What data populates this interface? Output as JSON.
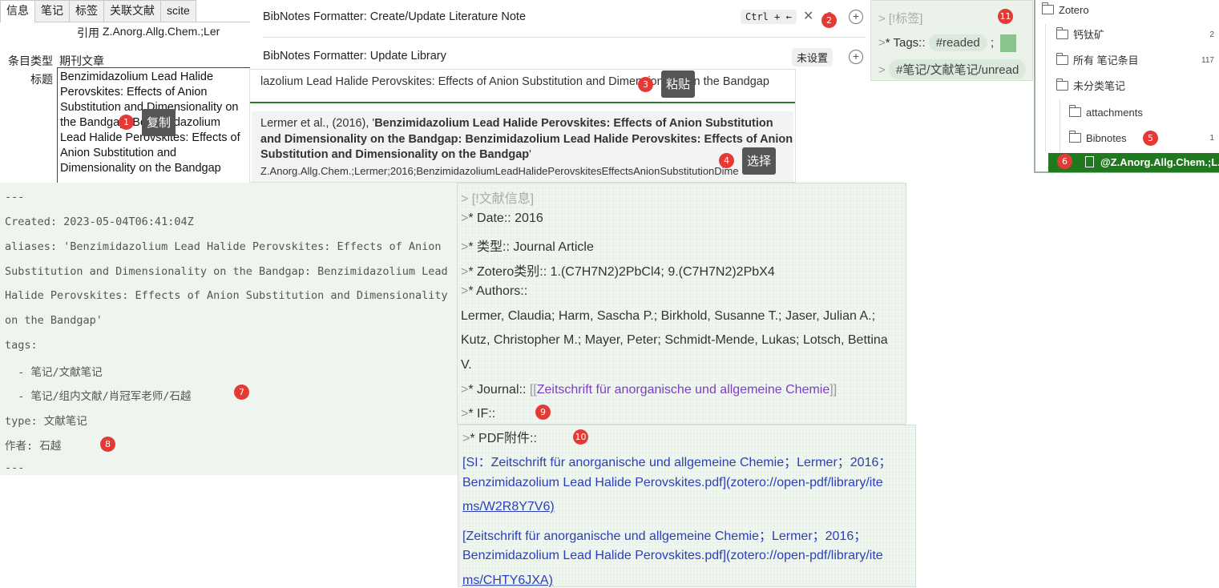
{
  "zotero": {
    "tabs": [
      "信息",
      "笔记",
      "标签",
      "关联文献",
      "scite"
    ],
    "cite_label": "引用",
    "cite_value": "Z.Anorg.Allg.Chem.;Ler",
    "item_type_label": "条目类型",
    "item_type_value": "期刊文章",
    "title_label": "标题",
    "title_lines": [
      "Benzimidazolium Lead Halide",
      "Perovskites: Effects of Anion",
      "Substitution and Dimensionality on",
      "the Bandgap: Benzimidazolium",
      "Lead Halide Perovskites: Effects of",
      "Anion Substitution and",
      "Dimensionality on the Bandgap"
    ]
  },
  "palette": {
    "cmd1_label": "BibNotes Formatter: Create/Update Literature Note",
    "cmd1_hotkey": "Ctrl + ←",
    "cmd2_label": "BibNotes Formatter: Update Library",
    "cmd2_hotkey": "未设置"
  },
  "search": {
    "query": "lazolium Lead Halide Perovskites: Effects of Anion Substitution and Dimensionality on the Bandgap",
    "result_prefix": "Lermer et al., (2016), '",
    "result_bold": "Benzimidazolium Lead Halide Perovskites: Effects of Anion Substitution and Dimensionality on the Bandgap: Benzimidazolium Lead Halide Perovskites: Effects of Anion Substitution and Dimensionality on the Bandgap",
    "result_suffix": "'",
    "result_key": "Z.Anorg.Allg.Chem.;Lermer;2016;BenzimidazoliumLeadHalidePerovskitesEffectsAnionSubstitutionDime"
  },
  "tags_callout": {
    "header": "> [!标签]",
    "tags_label": "* Tags::",
    "tag1": "#readed",
    "sep": ";",
    "tag2": "#笔记/文献笔记/unread"
  },
  "tree": {
    "root": "Zotero",
    "items": [
      {
        "label": "钙钛矿",
        "count": "2"
      },
      {
        "label": "所有 笔记条目",
        "count": "117"
      },
      {
        "label": "未分类笔记",
        "count": ""
      },
      {
        "label": "attachments",
        "count": ""
      },
      {
        "label": "Bibnotes",
        "count": "1"
      }
    ],
    "selected_file": "@Z.Anorg.Allg.Chem.;L..."
  },
  "yaml": {
    "lines": [
      "---",
      "Created: 2023-05-04T06:41:04Z",
      "aliases: 'Benzimidazolium Lead Halide Perovskites: Effects of Anion",
      "Substitution and Dimensionality on the Bandgap: Benzimidazolium Lead",
      "Halide Perovskites: Effects of Anion Substitution and Dimensionality",
      "on the Bandgap'",
      "tags:",
      "  - 笔记/文献笔记",
      "  - 笔记/组内文献/肖冠军老师/石越",
      "type: 文献笔记",
      "作者: 石越",
      "---"
    ]
  },
  "literature": {
    "header": "> [!文献信息]",
    "date": "* Date:: 2016",
    "type": "* 类型:: Journal Article",
    "category": "* Zotero类别:: 1.(C7H7N2)2PbCl4; 9.(C7H7N2)2PbX4",
    "authors_label": "* Authors::",
    "authors_lines": [
      "Lermer, Claudia; Harm, Sascha P.; Birkhold, Susanne T.; Jaser, Julian A.;",
      "Kutz, Christopher M.; Mayer, Peter; Schmidt-Mende, Lukas; Lotsch, Bettina",
      "V."
    ],
    "journal_label": "* Journal::",
    "journal_link": "Zeitschrift für anorganische und allgemeine Chemie",
    "if_label": "* IF::"
  },
  "pdf": {
    "label": "* PDF附件::",
    "lines": [
      "[SI：Zeitschrift für anorganische und allgemeine Chemie；Lermer；2016；",
      "Benzimidazolium Lead Halide Perovskites.pdf](zotero://open-pdf/library/ite",
      "ms/W2R8Y7V6)",
      "[Zeitschrift für anorganische und allgemeine Chemie；Lermer；2016；",
      "Benzimidazolium Lead Halide Perovskites.pdf](zotero://open-pdf/library/ite",
      "ms/CHTY6JXA)"
    ]
  },
  "annotations": {
    "tip_copy": "复制",
    "tip_paste": "粘贴",
    "tip_select": "选择",
    "b1": "1",
    "b2": "2",
    "b3": "3",
    "b4": "4",
    "b5": "5",
    "b6": "6",
    "b7": "7",
    "b8": "8",
    "b9": "9",
    "b10": "10",
    "b11": "11"
  },
  "colors": {
    "accent_green": "#2e7d32",
    "badge_red": "#e53935",
    "link_purple": "#7a3fbf",
    "link_blue": "#2a3fb8"
  }
}
